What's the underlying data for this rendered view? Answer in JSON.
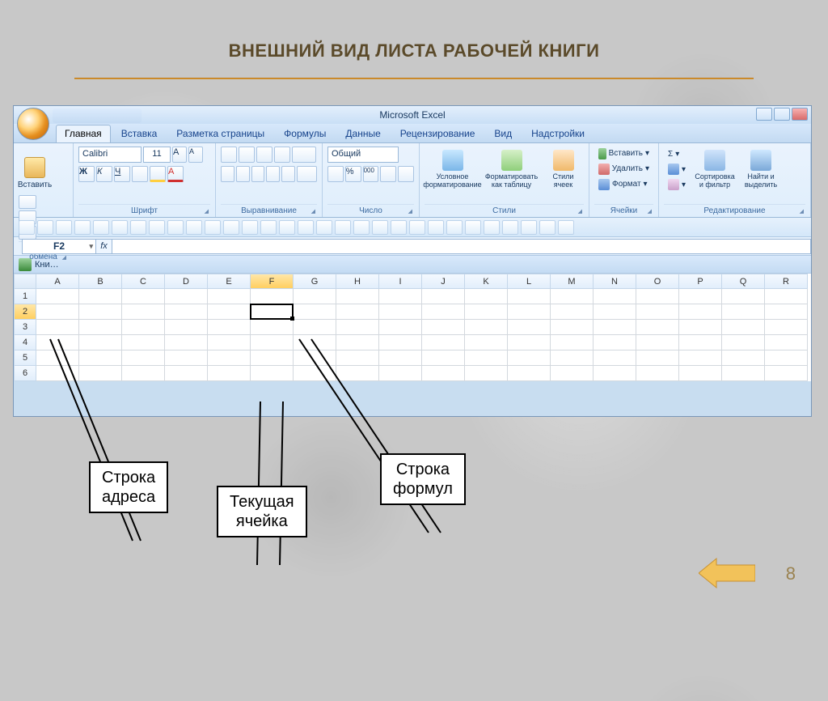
{
  "slide": {
    "title": "ВНЕШНИЙ ВИД ЛИСТА РАБОЧЕЙ КНИГИ",
    "page_number": "8"
  },
  "app": {
    "title": "Microsoft Excel",
    "workbook_label": "Кни…"
  },
  "tabs": [
    "Главная",
    "Вставка",
    "Разметка страницы",
    "Формулы",
    "Данные",
    "Рецензирование",
    "Вид",
    "Надстройки"
  ],
  "active_tab": 0,
  "ribbon_groups": {
    "clipboard": {
      "label": "Буфер обмена",
      "paste": "Вставить"
    },
    "font": {
      "label": "Шрифт",
      "font_name": "Calibri",
      "font_size": "11",
      "bold": "Ж",
      "italic": "К",
      "underline": "Ч"
    },
    "alignment": {
      "label": "Выравнивание"
    },
    "number": {
      "label": "Число",
      "format": "Общий",
      "percent": "%",
      "thousands": "000"
    },
    "styles": {
      "label": "Стили",
      "cond_format": "Условное форматирование",
      "as_table": "Форматировать как таблицу",
      "cell_styles": "Стили ячеек"
    },
    "cells": {
      "label": "Ячейки",
      "insert": "Вставить",
      "delete": "Удалить",
      "format": "Формат"
    },
    "editing": {
      "label": "Редактирование",
      "sort": "Сортировка и фильтр",
      "find": "Найти и выделить",
      "sum": "Σ"
    }
  },
  "namebox": "F2",
  "fx": "fx",
  "columns": [
    "A",
    "B",
    "C",
    "D",
    "E",
    "F",
    "G",
    "H",
    "I",
    "J",
    "K",
    "L",
    "M",
    "N",
    "O",
    "P",
    "Q",
    "R"
  ],
  "rows": [
    "1",
    "2",
    "3",
    "4",
    "5",
    "6"
  ],
  "active": {
    "col": "F",
    "row": "2"
  },
  "callouts": {
    "name_box": "Строка\nадреса",
    "active_cell": "Текущая\nячейка",
    "formula_bar": "Строка\nформул"
  }
}
